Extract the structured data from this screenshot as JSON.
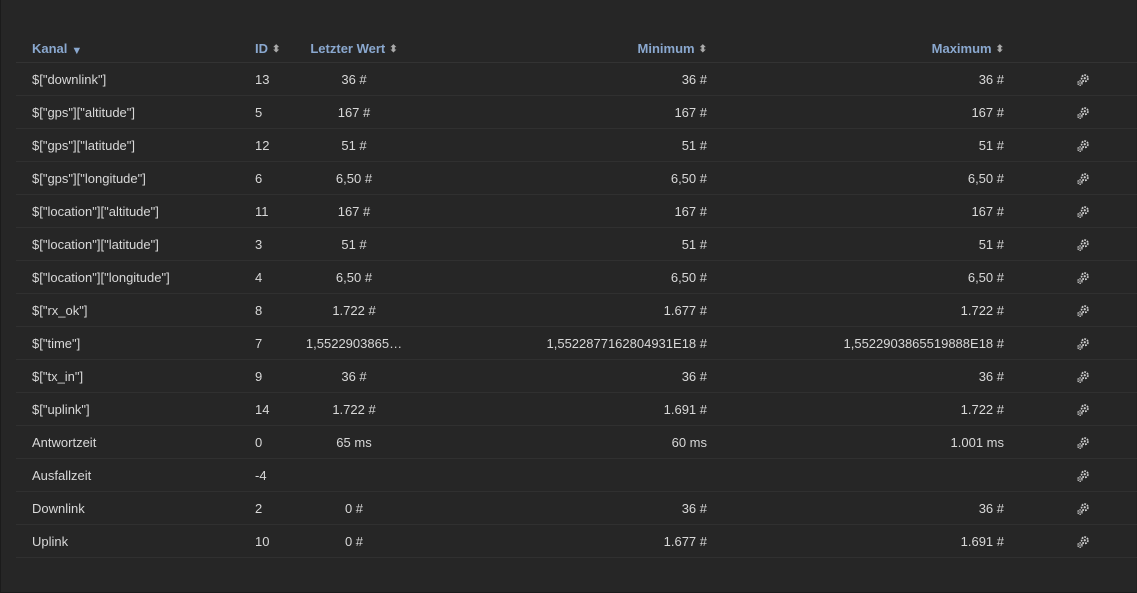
{
  "columns": {
    "kanal": "Kanal",
    "id": "ID",
    "last": "Letzter Wert",
    "min": "Minimum",
    "max": "Maximum",
    "sort_active_icon": "caret-down-icon",
    "sort_icon": "sort-updown-icon"
  },
  "rows": [
    {
      "kanal": "$[\"downlink\"]",
      "id": "13",
      "last": "36 #",
      "min": "36 #",
      "max": "36 #"
    },
    {
      "kanal": "$[\"gps\"][\"altitude\"]",
      "id": "5",
      "last": "167 #",
      "min": "167 #",
      "max": "167 #"
    },
    {
      "kanal": "$[\"gps\"][\"latitude\"]",
      "id": "12",
      "last": "51 #",
      "min": "51 #",
      "max": "51 #"
    },
    {
      "kanal": "$[\"gps\"][\"longitude\"]",
      "id": "6",
      "last": "6,50 #",
      "min": "6,50 #",
      "max": "6,50 #"
    },
    {
      "kanal": "$[\"location\"][\"altitude\"]",
      "id": "11",
      "last": "167 #",
      "min": "167 #",
      "max": "167 #"
    },
    {
      "kanal": "$[\"location\"][\"latitude\"]",
      "id": "3",
      "last": "51 #",
      "min": "51 #",
      "max": "51 #"
    },
    {
      "kanal": "$[\"location\"][\"longitude\"]",
      "id": "4",
      "last": "6,50 #",
      "min": "6,50 #",
      "max": "6,50 #"
    },
    {
      "kanal": "$[\"rx_ok\"]",
      "id": "8",
      "last": "1.722 #",
      "min": "1.677 #",
      "max": "1.722 #"
    },
    {
      "kanal": "$[\"time\"]",
      "id": "7",
      "last": "1,5522903865…",
      "min": "1,5522877162804931E18 #",
      "max": "1,5522903865519888E18 #"
    },
    {
      "kanal": "$[\"tx_in\"]",
      "id": "9",
      "last": "36 #",
      "min": "36 #",
      "max": "36 #"
    },
    {
      "kanal": "$[\"uplink\"]",
      "id": "14",
      "last": "1.722 #",
      "min": "1.691 #",
      "max": "1.722 #"
    },
    {
      "kanal": "Antwortzeit",
      "id": "0",
      "last": "65 ms",
      "min": "60 ms",
      "max": "1.001 ms"
    },
    {
      "kanal": "Ausfallzeit",
      "id": "-4",
      "last": "",
      "min": "",
      "max": ""
    },
    {
      "kanal": "Downlink",
      "id": "2",
      "last": "0 #",
      "min": "36 #",
      "max": "36 #"
    },
    {
      "kanal": "Uplink",
      "id": "10",
      "last": "0 #",
      "min": "1.677 #",
      "max": "1.691 #"
    }
  ],
  "row_action_icon": "settings-gear-icon",
  "colors": {
    "background": "#262626",
    "header_text": "#8aa8cf",
    "cell_text": "#d8d8d8"
  }
}
